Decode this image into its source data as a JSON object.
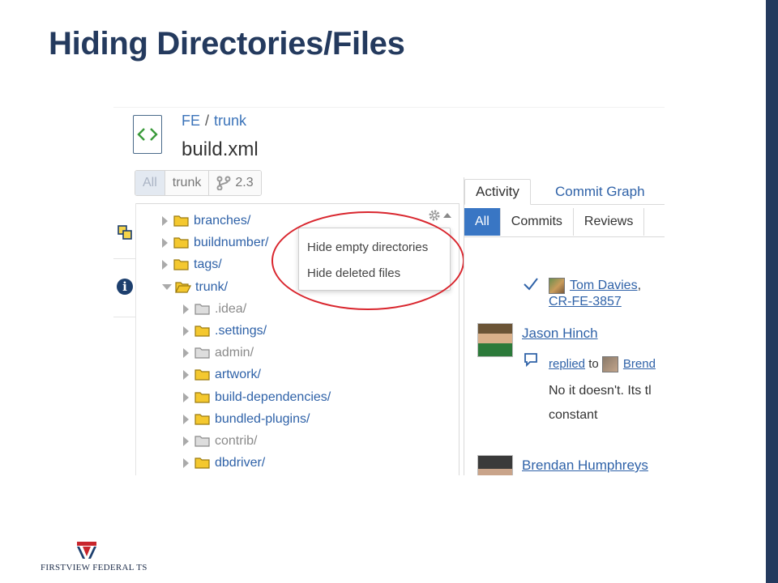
{
  "slide": {
    "title": "Hiding Directories/Files",
    "accent_color": "#243a5e"
  },
  "header": {
    "project": "FE",
    "separator": "/",
    "branch": "trunk",
    "file_name": "build.xml",
    "icon": "code-file-icon"
  },
  "branch_selector": {
    "options": [
      "All",
      "trunk",
      "2.3"
    ],
    "selected": "All"
  },
  "tree": {
    "items": [
      {
        "name": "branches/",
        "level": 0,
        "expanded": false,
        "style": "normal"
      },
      {
        "name": "buildnumber/",
        "level": 0,
        "expanded": false,
        "style": "normal"
      },
      {
        "name": "tags/",
        "level": 0,
        "expanded": false,
        "style": "normal"
      },
      {
        "name": "trunk/",
        "level": 0,
        "expanded": true,
        "style": "normal"
      },
      {
        "name": ".idea/",
        "level": 1,
        "expanded": false,
        "style": "deleted"
      },
      {
        "name": ".settings/",
        "level": 1,
        "expanded": false,
        "style": "normal"
      },
      {
        "name": "admin/",
        "level": 1,
        "expanded": false,
        "style": "deleted"
      },
      {
        "name": "artwork/",
        "level": 1,
        "expanded": false,
        "style": "normal"
      },
      {
        "name": "build-dependencies/",
        "level": 1,
        "expanded": false,
        "style": "normal"
      },
      {
        "name": "bundled-plugins/",
        "level": 1,
        "expanded": false,
        "style": "normal"
      },
      {
        "name": "contrib/",
        "level": 1,
        "expanded": false,
        "style": "deleted"
      },
      {
        "name": "dbdriver/",
        "level": 1,
        "expanded": false,
        "style": "normal"
      }
    ]
  },
  "dropdown": {
    "items": [
      "Hide empty directories",
      "Hide deleted files"
    ],
    "highlight_color": "#d9262e"
  },
  "activity": {
    "tabs": [
      "Activity",
      "Commit Graph"
    ],
    "active_tab": "Activity",
    "filters": [
      "All",
      "Commits",
      "Reviews"
    ],
    "active_filter": "All",
    "entries": {
      "review_user": "Tom Davies",
      "review_sep": ",",
      "review_id": "CR-FE-3857",
      "author1": "Jason Hinch",
      "action": "replied",
      "action_to": "to",
      "reply_target": "Brend",
      "comment_line1": "No it doesn't. Its tl",
      "comment_line2": "constant",
      "author2": "Brendan Humphreys"
    }
  },
  "logo": {
    "text": "FIRSTVIEW FEDERAL TS"
  }
}
